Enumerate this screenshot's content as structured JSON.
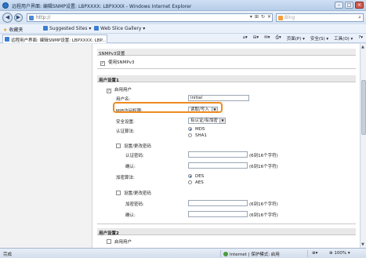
{
  "window": {
    "title": "远程用户界面: 编辑SNMP设置: LBPXXXX: LBPXXXX - Windows Internet Explorer"
  },
  "address_bar": {
    "url": "http://",
    "search_placeholder": "Bing"
  },
  "favorites_bar": {
    "favorites_label": "收藏夹",
    "items": [
      "Suggested Sites ▾",
      "Web Slice Gallery ▾"
    ]
  },
  "tab": {
    "label": "远程用户界面: 编辑SNMP设置: LBPXXXX: LBP..."
  },
  "command_bar": {
    "items": [
      "页面(P) ▾",
      "安全(S) ▾",
      "工具(O) ▾"
    ]
  },
  "form": {
    "snmpv3_section_title": "SNMPv3设置",
    "use_snmpv3_label": "使用SNMPv3",
    "user1": {
      "title": "用户设置1",
      "enable_label": "启用用户",
      "username_label": "用户名:",
      "username_value": "initial",
      "mib_access_label": "MIB访问权限:",
      "mib_access_value": "读取/写入",
      "security_label": "安全设置:",
      "security_value": "有认证/有加密",
      "auth_algo_label": "认证算法:",
      "auth_options": [
        "MD5",
        "SHA1"
      ],
      "set_auth_pw_label": "设置/更改密码",
      "auth_pw_label": "认证密码:",
      "confirm_label": "确认:",
      "pw_hint": "(6到16个字符)",
      "enc_algo_label": "加密算法:",
      "enc_options": [
        "DES",
        "AES"
      ],
      "set_enc_pw_label": "设置/更改密码",
      "enc_pw_label": "加密密码:",
      "confirm2_label": "确认:"
    },
    "user2": {
      "title": "用户设置2",
      "enable_label": "启用用户"
    }
  },
  "status_bar": {
    "status": "完成",
    "zone": "Internet | 保护模式: 启用",
    "zoom": "100%"
  }
}
